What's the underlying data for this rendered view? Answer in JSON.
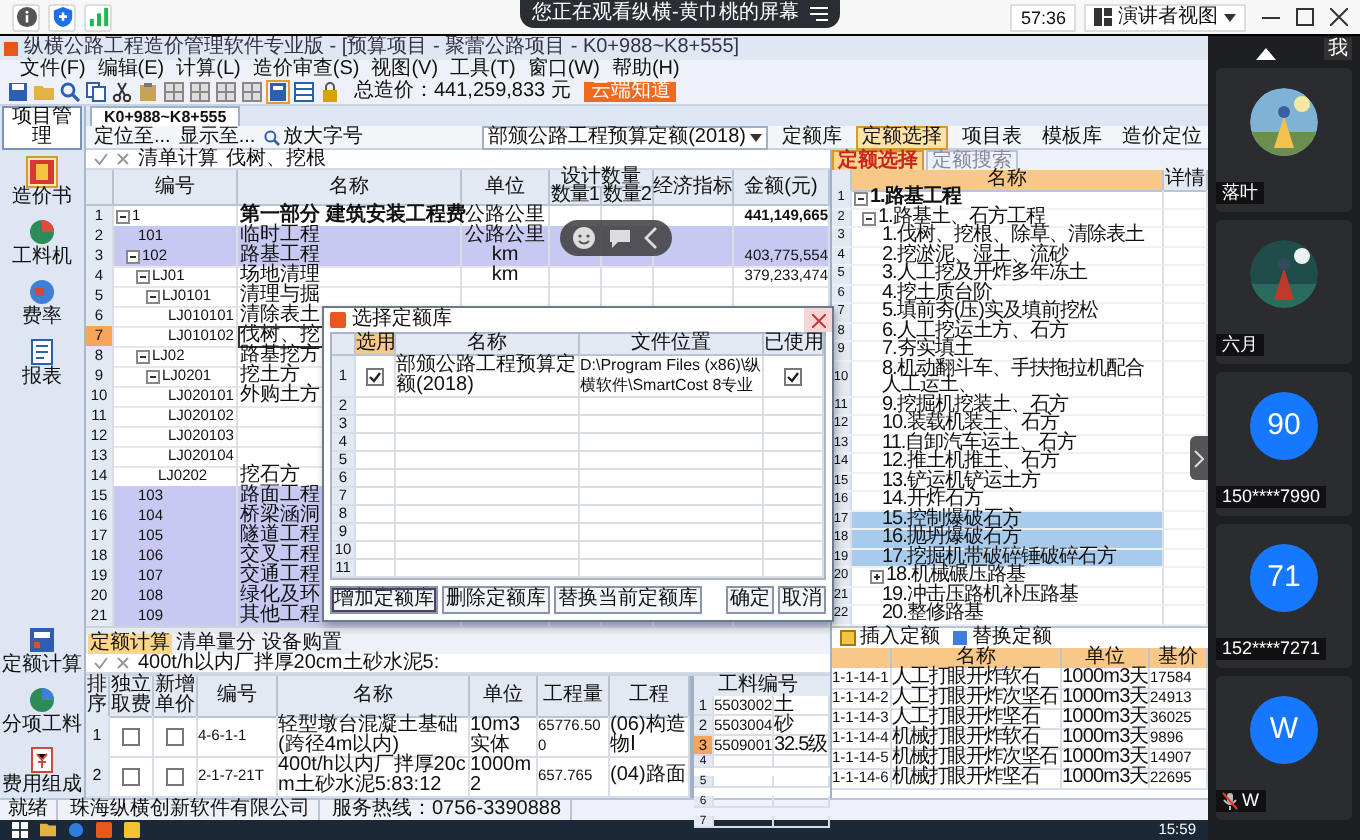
{
  "meeting": {
    "banner": "您正在观看纵横-黄巾桃的屏幕",
    "timer": "57:36",
    "view_button": "演讲者视图",
    "self_tag": "我"
  },
  "app": {
    "title": "纵横公路工程造价管理软件专业版 - [预算项目 - 聚蕾公路项目 - K0+988~K8+555]",
    "menu": [
      "文件(F)",
      "编辑(E)",
      "计算(L)",
      "造价审查(S)",
      "视图(V)",
      "工具(T)",
      "窗口(W)",
      "帮助(H)"
    ],
    "total": "总造价：441,259,833 元",
    "orange_button": "云端知道",
    "project_tab": "项目管理",
    "doc_tab": "K0+988~K8+555",
    "sidebar": [
      {
        "label": "造价书",
        "selected": true
      },
      {
        "label": "工料机",
        "selected": false
      },
      {
        "label": "费率",
        "selected": false
      },
      {
        "label": "报表",
        "selected": false
      }
    ],
    "sidebar_bottom": [
      "定额计算",
      "分项工料",
      "费用组成"
    ],
    "locate_buttons": [
      "定位至...",
      "显示至..."
    ],
    "zoom_button": "放大字号",
    "library": "部颁公路工程预算定额(2018)",
    "library_buttons": [
      {
        "label": "定额库",
        "selected": false
      },
      {
        "label": "定额选择",
        "selected": true
      },
      {
        "label": "项目表",
        "selected": false
      },
      {
        "label": "模板库",
        "selected": false
      },
      {
        "label": "造价定位",
        "selected": false
      }
    ],
    "formula": {
      "button": "清单计算",
      "value": "伐树、挖根"
    },
    "grid": {
      "columns": {
        "code": "编号",
        "name": "名称",
        "unit": "单位",
        "design_qty": "设计数量",
        "qty1": "数量1",
        "qty2": "数量2",
        "index": "经济指标",
        "amount": "金额(元)"
      },
      "rows": [
        {
          "num": "1",
          "code": "1",
          "name": "第一部分 建筑安装工程费",
          "unit": "公路公里",
          "amount": "441,149,665",
          "highlighted": false,
          "selected": false,
          "expanded": true,
          "children": [
            {
              "num": "2",
              "code": "101",
              "name": "临时工程",
              "unit": "公路公里",
              "highlighted": true,
              "selected": false
            },
            {
              "num": "3",
              "code": "102",
              "name": "路基工程",
              "unit": "km",
              "amount": "403,775,554",
              "highlighted": true,
              "selected": false,
              "expanded": true,
              "children": [
                {
                  "num": "4",
                  "code": "LJ01",
                  "name": "场地清理",
                  "unit": "km",
                  "amount": "379,233,474",
                  "highlighted": false,
                  "selected": false,
                  "expanded": true,
                  "children": [
                    {
                      "num": "5",
                      "code": "LJ0101",
                      "name": "清理与掘",
                      "highlighted": false,
                      "selected": false,
                      "expanded": true,
                      "children": [
                        {
                          "num": "6",
                          "code": "LJ010101",
                          "name": "清除表土",
                          "highlighted": false,
                          "selected": false
                        },
                        {
                          "num": "7",
                          "code": "LJ010102",
                          "name": "伐树、挖",
                          "highlighted": false,
                          "selected": true
                        }
                      ]
                    }
                  ]
                },
                {
                  "num": "8",
                  "code": "LJ02",
                  "name": "路基挖方",
                  "highlighted": false,
                  "selected": false,
                  "expanded": true,
                  "children": [
                    {
                      "num": "9",
                      "code": "LJ0201",
                      "name": "挖土方",
                      "highlighted": false,
                      "selected": false,
                      "expanded": true,
                      "children": [
                        {
                          "num": "10",
                          "code": "LJ020101",
                          "name": "外购土方",
                          "highlighted": false,
                          "selected": false
                        },
                        {
                          "num": "11",
                          "code": "LJ020102",
                          "highlighted": false,
                          "selected": false
                        },
                        {
                          "num": "12",
                          "code": "LJ020103",
                          "highlighted": false,
                          "selected": false
                        },
                        {
                          "num": "13",
                          "code": "LJ020104",
                          "highlighted": false,
                          "selected": false
                        }
                      ]
                    },
                    {
                      "num": "14",
                      "code": "LJ0202",
                      "name": "挖石方",
                      "highlighted": false,
                      "selected": false
                    }
                  ]
                }
              ]
            },
            {
              "num": "15",
              "code": "103",
              "name": "路面工程",
              "highlighted": true,
              "selected": false
            },
            {
              "num": "16",
              "code": "104",
              "name": "桥梁涵洞",
              "highlighted": true,
              "selected": false
            },
            {
              "num": "17",
              "code": "105",
              "name": "隧道工程",
              "highlighted": true,
              "selected": false
            },
            {
              "num": "18",
              "code": "106",
              "name": "交叉工程",
              "highlighted": true,
              "selected": false
            },
            {
              "num": "19",
              "code": "107",
              "name": "交通工程",
              "highlighted": true,
              "selected": false
            },
            {
              "num": "20",
              "code": "108",
              "name": "绿化及环",
              "highlighted": true,
              "selected": false
            },
            {
              "num": "21",
              "code": "109",
              "name": "其他工程",
              "highlighted": true,
              "selected": false
            }
          ]
        }
      ]
    },
    "dialog": {
      "title": "选择定额库",
      "columns": [
        "选用",
        "名称",
        "文件位置",
        "已使用"
      ],
      "rows": [
        {
          "num": "1",
          "checked": true,
          "name": "部颁公路工程预算定额(2018)",
          "path": "D:\\Program Files (x86)\\纵横软件\\SmartCost 8专业",
          "used": true
        }
      ],
      "empty_rows": [
        "2",
        "3",
        "4",
        "5",
        "6",
        "7",
        "8",
        "9",
        "10",
        "11"
      ],
      "buttons": [
        "增加定额库",
        "删除定额库",
        "替换当前定额库"
      ],
      "ok": "确定",
      "cancel": "取消"
    },
    "quota_tabs": [
      {
        "label": "定额选择",
        "selected": true
      },
      {
        "label": "定额搜索",
        "selected": false
      }
    ],
    "tree_columns": {
      "name": "名称",
      "detail": "详情"
    },
    "tree": [
      {
        "num": "1",
        "label": "1.路基工程",
        "selected": false,
        "expanded": true,
        "children": [
          {
            "num": "2",
            "label": "1.路基土、石方工程",
            "selected": false,
            "expanded": true,
            "children": [
              {
                "num": "3",
                "label": "1.伐树、挖根、除草、清除表土",
                "selected": false
              },
              {
                "num": "4",
                "label": "2.挖淤泥、湿土、流砂",
                "selected": false
              },
              {
                "num": "5",
                "label": "3.人工挖及开炸多年冻土",
                "selected": false
              },
              {
                "num": "6",
                "label": "4.挖土质台阶",
                "selected": false
              },
              {
                "num": "7",
                "label": "5.填前夯(压)实及填前挖松",
                "selected": false
              },
              {
                "num": "8",
                "label": "6.人工挖运土方、石方",
                "selected": false
              },
              {
                "num": "9",
                "label": "7.夯实填土",
                "selected": false
              },
              {
                "num": "10",
                "label": "8.机动翻斗车、手扶拖拉机配合人工运土、",
                "selected": false
              },
              {
                "num": "11",
                "label": "9.挖掘机挖装土、石方",
                "selected": false
              },
              {
                "num": "12",
                "label": "10.装载机装土、石方",
                "selected": false
              },
              {
                "num": "13",
                "label": "11.自卸汽车运土、石方",
                "selected": false
              },
              {
                "num": "14",
                "label": "12.推土机推土、石方",
                "selected": false
              },
              {
                "num": "15",
                "label": "13.铲运机铲运土方",
                "selected": false
              },
              {
                "num": "16",
                "label": "14.开炸石方",
                "selected": false
              },
              {
                "num": "17",
                "label": "15.控制爆破石方",
                "selected": true
              },
              {
                "num": "18",
                "label": "16.抛坍爆破石方",
                "selected": true
              },
              {
                "num": "19",
                "label": "17.挖掘机带破碎锤破碎石方",
                "selected": true
              },
              {
                "num": "20",
                "label": "18.机械碾压路基",
                "selected": false,
                "expanded": false
              },
              {
                "num": "21",
                "label": "19.冲击压路机补压路基",
                "selected": false
              },
              {
                "num": "22",
                "label": "20.整修路基",
                "selected": false
              }
            ]
          }
        ]
      }
    ],
    "insert_buttons": [
      "插入定额",
      "替换定额"
    ],
    "quota_table": {
      "columns": [
        "名称",
        "单位",
        "基价"
      ],
      "rows": [
        {
          "code": "1-1-14-1",
          "name": "人工打眼开炸软石",
          "unit": "1000m3天",
          "price": "17584"
        },
        {
          "code": "1-1-14-2",
          "name": "人工打眼开炸次坚石",
          "unit": "1000m3天",
          "price": "24913"
        },
        {
          "code": "1-1-14-3",
          "name": "人工打眼开炸坚石",
          "unit": "1000m3天",
          "price": "36025"
        },
        {
          "code": "1-1-14-4",
          "name": "机械打眼开炸软石",
          "unit": "1000m3天",
          "price": "9896"
        },
        {
          "code": "1-1-14-5",
          "name": "机械打眼开炸次坚石",
          "unit": "1000m3天",
          "price": "14907"
        },
        {
          "code": "1-1-14-6",
          "name": "机械打眼开炸坚石",
          "unit": "1000m3天",
          "price": "22695"
        }
      ]
    },
    "bottom_tabs": [
      {
        "label": "定额计算",
        "selected": true
      },
      {
        "label": "清单量分",
        "selected": false
      },
      {
        "label": "设备购置",
        "selected": false
      }
    ],
    "bottom_formula": "400t/h以内厂拌厚20cm土砂水泥5:",
    "bottom_table": {
      "columns": [
        "排序",
        "独立取费",
        "新增单价",
        "编号",
        "名称",
        "单位",
        "工程量",
        "工程"
      ],
      "rows": [
        {
          "num": "1",
          "independent": false,
          "new_price": false,
          "code": "4-6-1-1",
          "name": "轻型墩台混凝土基础(跨径4m以内)",
          "unit": "10m3实体",
          "qty": "65776.500",
          "category": "(06)构造物Ⅰ"
        },
        {
          "num": "2",
          "independent": false,
          "new_price": false,
          "code": "2-1-7-21T",
          "name": "400t/h以内厂拌厚20cm土砂水泥5:83:12",
          "unit": "1000m2",
          "qty": "657.765",
          "category": "(04)路面"
        }
      ]
    },
    "material_table": {
      "column": "工料编号",
      "rows": [
        {
          "num": "1",
          "code": "5503002",
          "name": "土",
          "selected": false
        },
        {
          "num": "2",
          "code": "5503004",
          "name": "砂",
          "selected": false
        },
        {
          "num": "3",
          "code": "5509001",
          "name": "32.5级",
          "selected": true
        }
      ],
      "empty_rows": [
        "4",
        "5",
        "6",
        "7"
      ]
    },
    "status": [
      "就绪",
      "珠海纵横创新软件有限公司",
      "服务热线：0756-3390888"
    ],
    "clock": "15:59"
  },
  "participants": [
    {
      "name": "落叶",
      "muted": false
    },
    {
      "name": "六月",
      "muted": false
    },
    {
      "kind": "initial",
      "initial": "90",
      "name": "150****7990",
      "muted": false
    },
    {
      "kind": "initial",
      "initial": "71",
      "name": "152****7271",
      "muted": false
    },
    {
      "kind": "initial",
      "initial": "W",
      "name": "W",
      "muted": true
    }
  ]
}
